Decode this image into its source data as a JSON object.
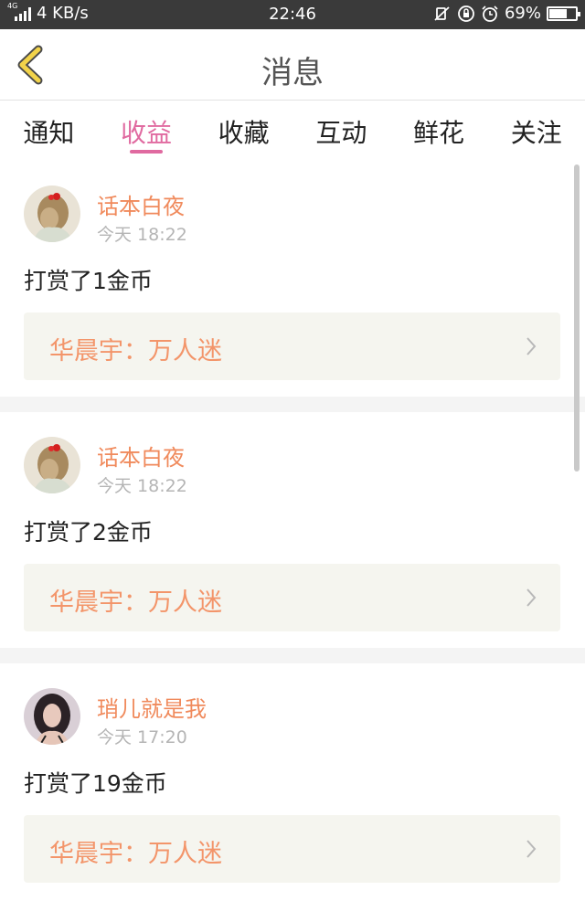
{
  "status_bar": {
    "network_type": "4G",
    "speed": "4 KB/s",
    "time": "22:46",
    "battery_percent_text": "69%",
    "battery_level": 0.69,
    "icons": [
      "signal-icon",
      "mute-icon",
      "rotation-lock-icon",
      "alarm-icon",
      "battery-icon"
    ]
  },
  "nav": {
    "title": "消息",
    "back_icon": "back-chevron-icon",
    "accent_color": "#f2d34a"
  },
  "tabs": [
    {
      "label": "通知",
      "active": false
    },
    {
      "label": "收益",
      "active": true
    },
    {
      "label": "收藏",
      "active": false
    },
    {
      "label": "互动",
      "active": false
    },
    {
      "label": "鲜花",
      "active": false
    },
    {
      "label": "关注",
      "active": false
    }
  ],
  "colors": {
    "active_tab": "#e06aa0",
    "username": "#f08a5c",
    "book_title": "#f3956a",
    "book_bg": "#f5f5ef"
  },
  "messages": [
    {
      "user": "话本白夜",
      "time": "今天 18:22",
      "text": "打赏了1金币",
      "book": "华晨宇：万人迷",
      "avatar": "avatar-girl-red-bow"
    },
    {
      "user": "话本白夜",
      "time": "今天 18:22",
      "text": "打赏了2金币",
      "book": "华晨宇：万人迷",
      "avatar": "avatar-girl-red-bow"
    },
    {
      "user": "琑儿就是我",
      "time": "今天 17:20",
      "text": "打赏了19金币",
      "book": "华晨宇：万人迷",
      "avatar": "avatar-woman-dark-hair"
    }
  ]
}
